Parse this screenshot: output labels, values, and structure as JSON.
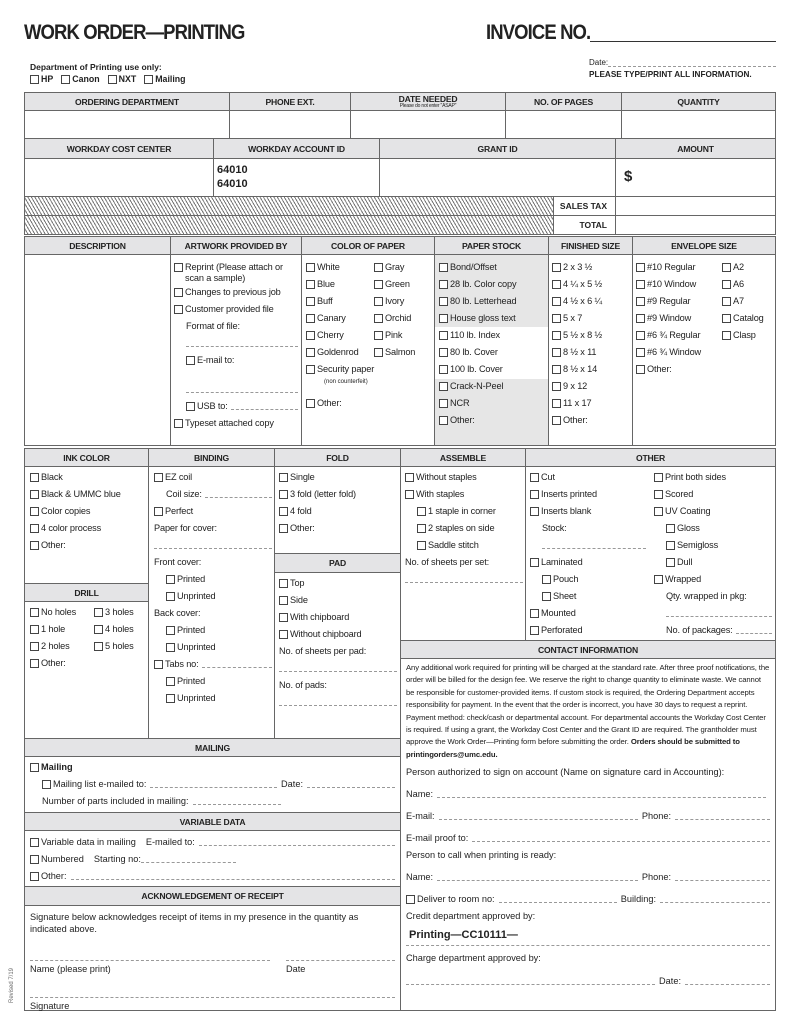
{
  "header": {
    "title": "WORK ORDER—PRINTING",
    "invoice_label": "INVOICE NO.",
    "dept_use_label": "Department of Printing use only:",
    "dept_use_options": [
      "HP",
      "Canon",
      "NXT",
      "Mailing"
    ],
    "date_label": "Date:",
    "instruction": "PLEASE TYPE/PRINT ALL INFORMATION."
  },
  "row1": {
    "headers": [
      "ORDERING DEPARTMENT",
      "PHONE EXT.",
      "DATE NEEDED",
      "NO. OF PAGES",
      "QUANTITY"
    ],
    "date_note": "Please do not enter \"ASAP\""
  },
  "row2": {
    "headers": [
      "WORKDAY COST CENTER",
      "WORKDAY ACCOUNT ID",
      "GRANT ID",
      "AMOUNT"
    ],
    "account_ids": [
      "64010",
      "64010"
    ],
    "amount_symbol": "$",
    "sales_tax": "SALES TAX",
    "total": "TOTAL"
  },
  "sections": {
    "description": "DESCRIPTION",
    "artwork": "ARTWORK PROVIDED BY",
    "color": "COLOR OF PAPER",
    "stock": "PAPER STOCK",
    "finished": "FINISHED SIZE",
    "envelope": "ENVELOPE SIZE",
    "ink": "INK COLOR",
    "binding": "BINDING",
    "fold": "FOLD",
    "assemble": "ASSEMBLE",
    "other": "OTHER",
    "drill": "DRILL",
    "pad": "PAD",
    "contact": "CONTACT INFORMATION",
    "mailing": "MAILING",
    "variable": "VARIABLE DATA",
    "ack": "ACKNOWLEDGEMENT OF RECEIPT"
  },
  "artwork": [
    {
      "t": "c",
      "l": "Reprint (Please attach or scan a sample)",
      "w": 1
    },
    {
      "t": "c",
      "l": "Changes to previous job"
    },
    {
      "t": "c",
      "l": "Customer provided file"
    },
    {
      "t": "x",
      "l": "Format of file:",
      "s": 1
    },
    {
      "t": "b",
      "s": 1
    },
    {
      "t": "c",
      "l": "E-mail to:",
      "s": 1,
      "h": 1
    },
    {
      "t": "b",
      "s": 1
    },
    {
      "t": "c",
      "l": "USB to:",
      "s": 1,
      "bl": 1
    },
    {
      "t": "c",
      "l": "Typeset attached copy"
    }
  ],
  "color_a": [
    {
      "t": "c",
      "l": "White"
    },
    {
      "t": "c",
      "l": "Blue"
    },
    {
      "t": "c",
      "l": "Buff"
    },
    {
      "t": "c",
      "l": "Canary"
    },
    {
      "t": "c",
      "l": "Cherry"
    },
    {
      "t": "c",
      "l": "Goldenrod"
    },
    {
      "t": "c",
      "l": "Security paper"
    },
    {
      "t": "n",
      "l": "(non counterfeit)"
    },
    {
      "t": "sp"
    },
    {
      "t": "c",
      "l": "Other:"
    }
  ],
  "color_b": [
    {
      "t": "c",
      "l": "Gray"
    },
    {
      "t": "c",
      "l": "Green"
    },
    {
      "t": "c",
      "l": "Ivory"
    },
    {
      "t": "c",
      "l": "Orchid"
    },
    {
      "t": "c",
      "l": "Pink"
    },
    {
      "t": "c",
      "l": "Salmon"
    }
  ],
  "stock": [
    {
      "t": "c",
      "l": "Bond/Offset"
    },
    {
      "t": "c",
      "l": "28 lb. Color copy"
    },
    {
      "t": "c",
      "l": "80 lb. Letterhead"
    },
    {
      "t": "c",
      "l": "House gloss text"
    },
    {
      "t": "c",
      "l": "110 lb. Index"
    },
    {
      "t": "c",
      "l": "80 lb. Cover"
    },
    {
      "t": "c",
      "l": "100 lb. Cover"
    },
    {
      "t": "c",
      "l": "Crack-N-Peel"
    },
    {
      "t": "c",
      "l": "NCR"
    },
    {
      "t": "c",
      "l": "Other:"
    }
  ],
  "finished": [
    {
      "t": "c",
      "l": "2 x 3 ½"
    },
    {
      "t": "c",
      "l": "4 ¼ x 5 ½"
    },
    {
      "t": "c",
      "l": "4 ½ x 6 ¼"
    },
    {
      "t": "c",
      "l": "5 x 7"
    },
    {
      "t": "c",
      "l": "5 ½ x 8 ½"
    },
    {
      "t": "c",
      "l": "8 ½ x 11"
    },
    {
      "t": "c",
      "l": "8 ½ x 14"
    },
    {
      "t": "c",
      "l": "9 x 12"
    },
    {
      "t": "c",
      "l": "11 x 17"
    },
    {
      "t": "c",
      "l": "Other:"
    }
  ],
  "envelope_a": [
    {
      "t": "c",
      "l": "#10 Regular"
    },
    {
      "t": "c",
      "l": "#10 Window"
    },
    {
      "t": "c",
      "l": "#9 Regular"
    },
    {
      "t": "c",
      "l": "#9 Window"
    },
    {
      "t": "c",
      "l": "#6 ¾ Regular"
    },
    {
      "t": "c",
      "l": "#6 ¾ Window"
    },
    {
      "t": "c",
      "l": "Other:"
    }
  ],
  "envelope_b": [
    {
      "t": "c",
      "l": "A2"
    },
    {
      "t": "c",
      "l": "A6"
    },
    {
      "t": "c",
      "l": "A7"
    },
    {
      "t": "c",
      "l": "Catalog"
    },
    {
      "t": "c",
      "l": "Clasp"
    }
  ],
  "ink": [
    {
      "t": "c",
      "l": "Black"
    },
    {
      "t": "c",
      "l": "Black & UMMC blue"
    },
    {
      "t": "c",
      "l": "Color copies"
    },
    {
      "t": "c",
      "l": "4 color process"
    },
    {
      "t": "c",
      "l": "Other:"
    }
  ],
  "drill_a": [
    {
      "t": "c",
      "l": "No holes"
    },
    {
      "t": "c",
      "l": "1 hole"
    },
    {
      "t": "c",
      "l": "2 holes"
    },
    {
      "t": "c",
      "l": "Other:"
    }
  ],
  "drill_b": [
    {
      "t": "c",
      "l": "3 holes"
    },
    {
      "t": "c",
      "l": "4 holes"
    },
    {
      "t": "c",
      "l": "5 holes"
    }
  ],
  "binding": [
    {
      "t": "c",
      "l": "EZ coil"
    },
    {
      "t": "x",
      "l": "Coil size:",
      "s": 1,
      "bl": 1
    },
    {
      "t": "c",
      "l": "Perfect"
    },
    {
      "t": "x",
      "l": "Paper for cover:"
    },
    {
      "t": "b"
    },
    {
      "t": "x",
      "l": "Front cover:"
    },
    {
      "t": "c",
      "l": "Printed",
      "s": 1
    },
    {
      "t": "c",
      "l": "Unprinted",
      "s": 1
    },
    {
      "t": "x",
      "l": "Back cover:"
    },
    {
      "t": "c",
      "l": "Printed",
      "s": 1
    },
    {
      "t": "c",
      "l": "Unprinted",
      "s": 1
    },
    {
      "t": "c",
      "l": "Tabs no:",
      "bl": 1
    },
    {
      "t": "c",
      "l": "Printed",
      "s": 1
    },
    {
      "t": "c",
      "l": "Unprinted",
      "s": 1
    }
  ],
  "fold": [
    {
      "t": "c",
      "l": "Single"
    },
    {
      "t": "c",
      "l": "3 fold (letter fold)"
    },
    {
      "t": "c",
      "l": "4 fold"
    },
    {
      "t": "c",
      "l": "Other:"
    }
  ],
  "pad": [
    {
      "t": "c",
      "l": "Top"
    },
    {
      "t": "c",
      "l": "Side"
    },
    {
      "t": "c",
      "l": "With chipboard"
    },
    {
      "t": "c",
      "l": "Without chipboard"
    },
    {
      "t": "x",
      "l": "No. of sheets per pad:"
    },
    {
      "t": "b"
    },
    {
      "t": "x",
      "l": "No. of pads:"
    },
    {
      "t": "b"
    }
  ],
  "assemble": [
    {
      "t": "c",
      "l": "Without staples"
    },
    {
      "t": "c",
      "l": "With staples"
    },
    {
      "t": "c",
      "l": "1 staple in corner",
      "s": 1
    },
    {
      "t": "c",
      "l": "2 staples on side",
      "s": 1
    },
    {
      "t": "c",
      "l": "Saddle stitch",
      "s": 1
    },
    {
      "t": "x",
      "l": "No. of sheets per set:"
    },
    {
      "t": "b"
    }
  ],
  "other_a": [
    {
      "t": "c",
      "l": "Cut"
    },
    {
      "t": "c",
      "l": "Inserts printed"
    },
    {
      "t": "c",
      "l": "Inserts blank"
    },
    {
      "t": "x",
      "l": "Stock:",
      "s": 1
    },
    {
      "t": "b",
      "s": 1
    },
    {
      "t": "c",
      "l": "Laminated"
    },
    {
      "t": "c",
      "l": "Pouch",
      "s": 1
    },
    {
      "t": "c",
      "l": "Sheet",
      "s": 1
    },
    {
      "t": "c",
      "l": "Mounted"
    },
    {
      "t": "c",
      "l": "Perforated"
    }
  ],
  "other_b": [
    {
      "t": "c",
      "l": "Print both sides"
    },
    {
      "t": "c",
      "l": "Scored"
    },
    {
      "t": "c",
      "l": "UV Coating"
    },
    {
      "t": "c",
      "l": "Gloss",
      "s": 1
    },
    {
      "t": "c",
      "l": "Semigloss",
      "s": 1
    },
    {
      "t": "c",
      "l": "Dull",
      "s": 1
    },
    {
      "t": "c",
      "l": "Wrapped"
    },
    {
      "t": "x",
      "l": "Qty. wrapped in pkg:",
      "s": 1
    },
    {
      "t": "b",
      "s": 1
    },
    {
      "t": "x",
      "l": "No. of packages:",
      "s": 1,
      "bl": 1
    }
  ],
  "contact": {
    "terms": "Any additional work required for printing will be charged at the standard rate. After three proof notifications, the order will be billed for the design fee. We reserve the right to change quantity to eliminate waste. We cannot be responsible for customer-provided items. If custom stock is required, the Ordering Department accepts responsibility for payment. In the event that the order is incorrect, you have 30 days to request a reprint. Payment method: check/cash or departmental account. For departmental accounts the Workday Cost Center is required. If using a grant, the Workday Cost Center and the Grant ID are required. The grantholder must approve the Work Order—Printing form before submitting the order. ",
    "terms_bold": "Orders should be submitted to printingorders@umc.edu.",
    "authorized": "Person authorized to sign on account (Name on signature card in Accounting):",
    "name": "Name:",
    "email": "E-mail:",
    "phone": "Phone:",
    "email_proof": "E-mail proof to:",
    "call_person": "Person to call when printing is ready:",
    "name2": "Name:",
    "phone2": "Phone:",
    "deliver": "Deliver to room no:",
    "building": "Building:",
    "credit": "Credit department approved by:",
    "credit_value": "Printing—CC10111—",
    "charge": "Charge department approved by:",
    "date": "Date:"
  },
  "mailing": {
    "mailing": "Mailing",
    "list": "Mailing list e-mailed to:",
    "date": "Date:",
    "parts": "Number of parts included in mailing:"
  },
  "variable": {
    "vdata": "Variable data in mailing",
    "emailed": "E-mailed to:",
    "numbered": "Numbered",
    "starting": "Starting no:",
    "other": "Other:"
  },
  "ack": {
    "text": "Signature below acknowledges receipt of items in my presence in the quantity as indicated above.",
    "name": "Name (please print)",
    "date": "Date",
    "signature": "Signature"
  },
  "revised": "Revised 7/19"
}
